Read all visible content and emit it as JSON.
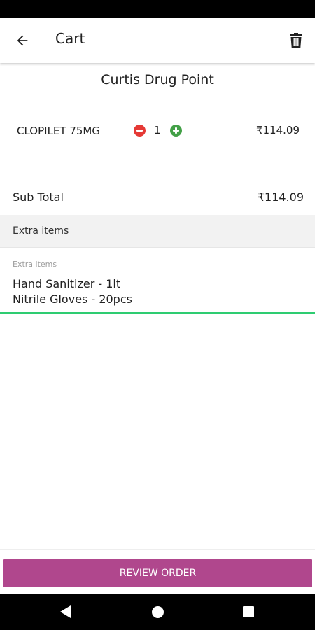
{
  "app_bar": {
    "title": "Cart",
    "back_icon": "arrow-left-icon",
    "delete_icon": "trash-icon"
  },
  "store": {
    "name": "Curtis Drug Point"
  },
  "cart_items": [
    {
      "name": "CLOPILET 75MG",
      "quantity": "1",
      "price": "₹114.09"
    }
  ],
  "subtotal": {
    "label": "Sub Total",
    "value": "₹114.09"
  },
  "extra_items": {
    "section_label": "Extra items",
    "field_label": "Extra items",
    "field_value": "Hand Sanitizer - 1lt\nNitrile Gloves - 20pcs"
  },
  "footer": {
    "review_button_label": "REVIEW ORDER"
  },
  "colors": {
    "accent": "#b0478d",
    "minus": "#e53935",
    "plus": "#43a047",
    "field_underline": "#2ecc71"
  }
}
